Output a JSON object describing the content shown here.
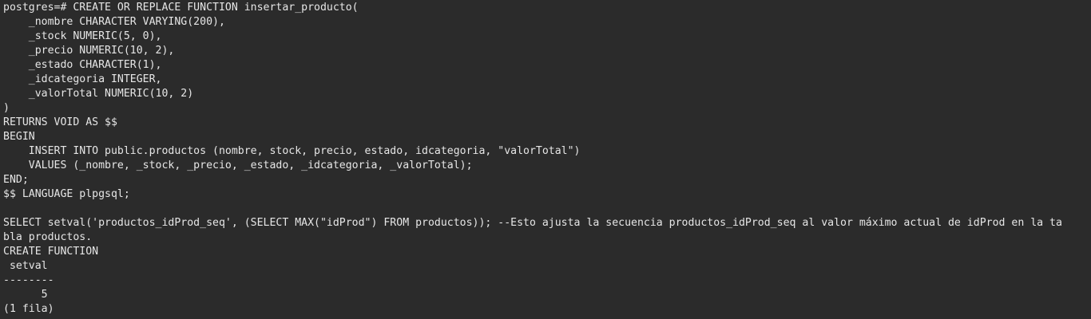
{
  "terminal": {
    "lines": [
      "postgres=# CREATE OR REPLACE FUNCTION insertar_producto(",
      "    _nombre CHARACTER VARYING(200),",
      "    _stock NUMERIC(5, 0),",
      "    _precio NUMERIC(10, 2),",
      "    _estado CHARACTER(1),",
      "    _idcategoria INTEGER,",
      "    _valorTotal NUMERIC(10, 2)",
      ")",
      "RETURNS VOID AS $$",
      "BEGIN",
      "    INSERT INTO public.productos (nombre, stock, precio, estado, idcategoria, \"valorTotal\")",
      "    VALUES (_nombre, _stock, _precio, _estado, _idcategoria, _valorTotal);",
      "END;",
      "$$ LANGUAGE plpgsql;",
      "",
      "SELECT setval('productos_idProd_seq', (SELECT MAX(\"idProd\") FROM productos)); --Esto ajusta la secuencia productos_idProd_seq al valor máximo actual de idProd en la ta",
      "bla productos.",
      "CREATE FUNCTION",
      " setval",
      "--------",
      "      5",
      "(1 fila)"
    ]
  }
}
